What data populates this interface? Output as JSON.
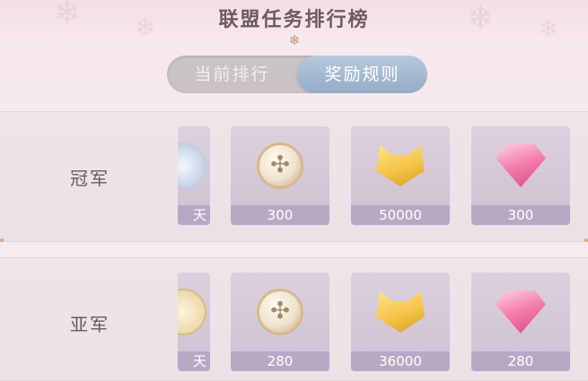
{
  "title": "联盟任务排行榜",
  "tabs": {
    "current": "当前排行",
    "rules": "奖励规则",
    "active": "rules"
  },
  "colors": {
    "tab_active": "#93acc7",
    "qty_bar": "#b9a8c4",
    "card_bg": "#d6c8d9"
  },
  "ranks": [
    {
      "label": "冠军",
      "rewards": [
        {
          "icon": "crystal-orb-icon",
          "qty": "天",
          "partial": true
        },
        {
          "icon": "compass-coin-icon",
          "qty": "300"
        },
        {
          "icon": "gold-cat-ingot-icon",
          "qty": "50000"
        },
        {
          "icon": "pink-diamond-icon",
          "qty": "300"
        }
      ]
    },
    {
      "label": "亚军",
      "rewards": [
        {
          "icon": "gold-orb-icon",
          "qty": "天",
          "partial": true
        },
        {
          "icon": "compass-coin-icon",
          "qty": "280"
        },
        {
          "icon": "gold-cat-ingot-icon",
          "qty": "36000"
        },
        {
          "icon": "pink-diamond-icon",
          "qty": "280"
        }
      ]
    }
  ]
}
